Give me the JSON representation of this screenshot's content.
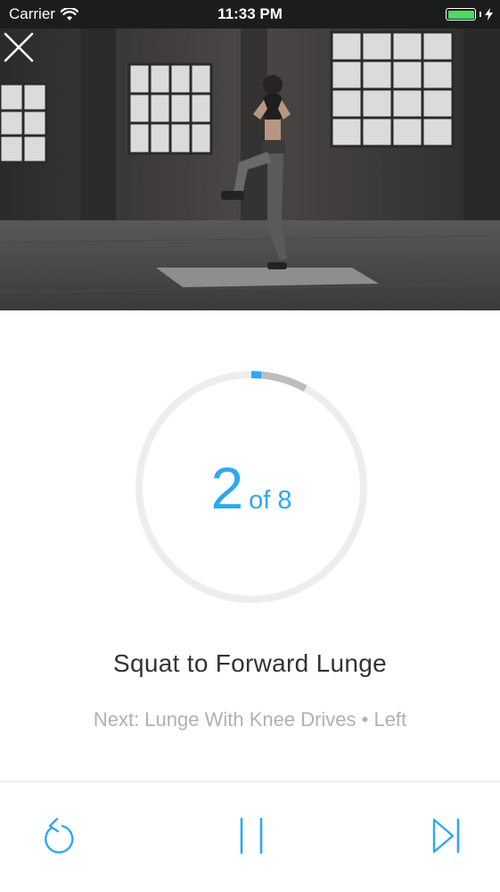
{
  "status_bar": {
    "carrier": "Carrier",
    "time": "11:33 PM",
    "battery_level": 1.0,
    "battery_color": "#4cd964"
  },
  "video": {
    "close_icon": "close-icon"
  },
  "workout": {
    "current": "2",
    "of_total": "of 8",
    "progress_fraction": 0.08,
    "exercise_title": "Squat to Forward Lunge",
    "next_label": "Next: Lunge With Knee Drives • Left"
  },
  "controls": {
    "replay_icon": "replay-icon",
    "pause_icon": "pause-icon",
    "skip_icon": "skip-next-icon"
  },
  "colors": {
    "accent": "#2ea8f2",
    "ring_track": "#ededed",
    "ring_elapsed": "#bdbdbd"
  }
}
